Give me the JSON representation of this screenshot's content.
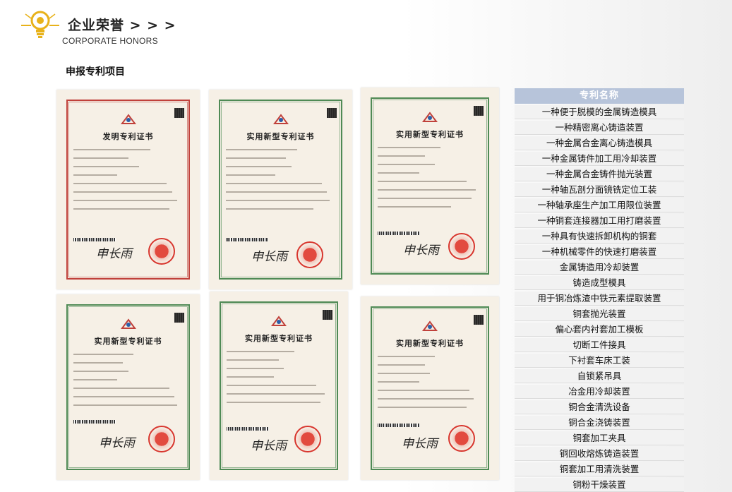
{
  "header": {
    "title_cn": "企业荣誉 > > >",
    "title_en": "CORPORATE HONORS",
    "icon": "lightbulb-icon",
    "accent_color": "#e8b21a"
  },
  "section": {
    "title": "申报专利项目"
  },
  "certificates": [
    {
      "type": "发明专利证书",
      "border_color": "#c0413b"
    },
    {
      "type": "实用新型专利证书",
      "border_color": "#4f8a55"
    },
    {
      "type": "实用新型专利证书",
      "border_color": "#4f8a55"
    },
    {
      "type": "实用新型专利证书",
      "border_color": "#4f8a55"
    },
    {
      "type": "实用新型专利证书",
      "border_color": "#4f8a55"
    },
    {
      "type": "实用新型专利证书",
      "border_color": "#4f8a55"
    }
  ],
  "patent_list": {
    "header": "专利名称",
    "items": [
      "一种便于脱模的金属铸造模具",
      "一种精密离心铸造装置",
      "一种金属合金离心铸造模具",
      "一种金属铸件加工用冷却装置",
      "一种金属合金铸件抛光装置",
      "一种轴瓦剖分面镜铣定位工装",
      "一种轴承座生产加工用限位装置",
      "一种铜套连接器加工用打磨装置",
      "一种具有快速拆卸机构的铜套",
      "一种机械零件的快速打磨装置",
      "金属铸造用冷却装置",
      "铸造成型模具",
      "用于铜冶炼渣中铁元素提取装置",
      "铜套抛光装置",
      "偏心套内衬套加工模板",
      "切断工件接具",
      "下衬套车床工装",
      "自锁紧吊具",
      "冶金用冷却装置",
      "铜合金清洗设备",
      "铜合金浇铸装置",
      "铜套加工夹具",
      "铜回收熔炼铸造装置",
      "铜套加工用清洗装置",
      "铜粉干燥装置"
    ]
  }
}
